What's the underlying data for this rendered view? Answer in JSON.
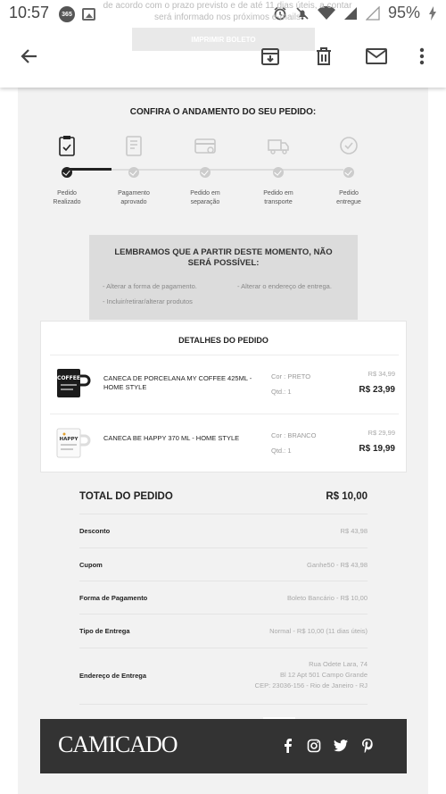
{
  "status_bar": {
    "time": "10:57",
    "badge": "365",
    "battery": "95%",
    "peek_line_1": "de acordo com o prazo previsto e de até 11 dias úteis, a contar",
    "peek_line_2": "será informado nos próximos e-mails"
  },
  "app_bar": {
    "boleto_button": "IMPRIMIR BOLETO"
  },
  "progress": {
    "title": "CONFIRA O ANDAMENTO DO SEU PEDIDO:",
    "steps": [
      {
        "label_1": "Pedido",
        "label_2": "Realizado",
        "active": true
      },
      {
        "label_1": "Pagamento",
        "label_2": "aprovado",
        "active": false
      },
      {
        "label_1": "Pedido em",
        "label_2": "separação",
        "active": false
      },
      {
        "label_1": "Pedido em",
        "label_2": "transporte",
        "active": false
      },
      {
        "label_1": "Pedido",
        "label_2": "entregue",
        "active": false
      }
    ]
  },
  "notice": {
    "title": "LEMBRAMOS QUE A PARTIR DESTE MOMENTO, NÃO SERÁ POSSÍVEL:",
    "items": [
      "- Alterar a forma de pagamento.",
      "- Alterar o endereço de entrega.",
      "- Incluir/retirar/alterar produtos"
    ]
  },
  "details": {
    "title": "DETALHES DO PEDIDO",
    "products": [
      {
        "name": "CANECA DE PORCELANA MY COFFEE 425ML - HOME STYLE",
        "color": "Cor : PRETO",
        "qty": "Qtd.: 1",
        "old_price": "R$ 34,99",
        "price": "R$ 23,99",
        "mug_text": "COFFEE"
      },
      {
        "name": "CANECA BE HAPPY 370 ML - HOME STYLE",
        "color": "Cor : BRANCO",
        "qty": "Qtd.: 1",
        "old_price": "R$ 29,99",
        "price": "R$ 19,99",
        "mug_text": "HAPPY"
      }
    ]
  },
  "summary": {
    "total_label": "TOTAL DO PEDIDO",
    "total_value": "R$ 10,00",
    "rows": [
      {
        "label": "Desconto",
        "value": "R$ 43,98"
      },
      {
        "label": "Cupom",
        "value": "Ganhe50 -  R$ 43,98"
      },
      {
        "label": "Forma de Pagamento",
        "value": "Boleto Bancário - R$ 10,00"
      },
      {
        "label": "Tipo de Entrega",
        "value": "Normal - R$ 10,00 (11 dias úteis)"
      }
    ],
    "address_label": "Endereço de Entrega",
    "address_line_1": "Rua Odete Lara, 74",
    "address_line_2": "Bl 12 Apt 501   Campo Grande",
    "address_line_3": "CEP: 23036-156 - Rio de Janeiro - RJ"
  },
  "footer": {
    "logo": "CAMICADO",
    "social_icons": [
      "facebook-icon",
      "instagram-icon",
      "twitter-icon",
      "pinterest-icon"
    ]
  },
  "colors": {
    "content_bg": "#f2f2f2",
    "footer_bg": "#333333",
    "active_step": "#222222"
  }
}
